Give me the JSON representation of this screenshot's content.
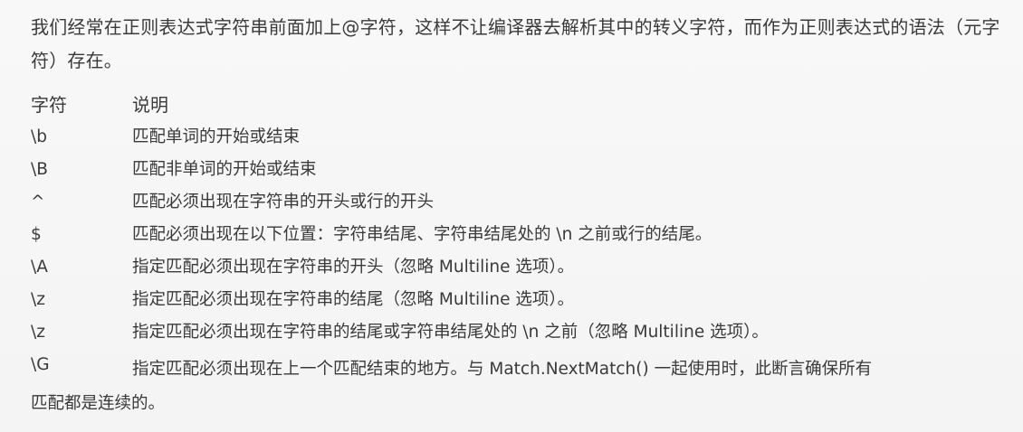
{
  "intro": "我们经常在正则表达式字符串前面加上@字符，这样不让编译器去解析其中的转义字符，而作为正则表达式的语法（元字符）存在。",
  "table": {
    "header": {
      "symbol": "字符",
      "description": "说明"
    },
    "rows": [
      {
        "symbol": "\\b",
        "description": "匹配单词的开始或结束"
      },
      {
        "symbol": "\\B",
        "description": "匹配非单词的开始或结束"
      },
      {
        "symbol": "^",
        "description": "匹配必须出现在字符串的开头或行的开头"
      },
      {
        "symbol": "$",
        "description": "匹配必须出现在以下位置：字符串结尾、字符串结尾处的 \\n 之前或行的结尾。"
      },
      {
        "symbol": "\\A",
        "description": "指定匹配必须出现在字符串的开头（忽略 Multiline 选项）。"
      },
      {
        "symbol": "\\z",
        "description": "指定匹配必须出现在字符串的结尾（忽略 Multiline 选项）。"
      },
      {
        "symbol": "\\z",
        "description": "指定匹配必须出现在字符串的结尾或字符串结尾处的 \\n 之前（忽略 Multiline 选项）。"
      }
    ],
    "last": {
      "symbol": "\\G",
      "description_line1": "指定匹配必须出现在上一个匹配结束的地方。与 Match.NextMatch() 一起使用时，此断言确保所有",
      "description_line2": "匹配都是连续的。"
    }
  }
}
